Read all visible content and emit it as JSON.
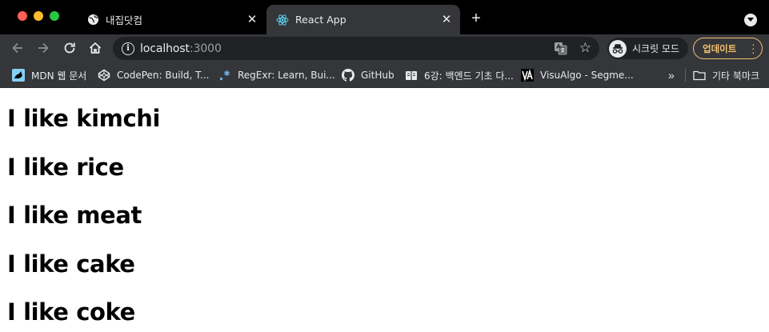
{
  "browser": {
    "tabs": [
      {
        "title": "내집닷컴",
        "favicon": "globe-icon",
        "active": false
      },
      {
        "title": "React App",
        "favicon": "react-icon",
        "active": true
      }
    ],
    "address": {
      "host": "localhost",
      "port": ":3000"
    },
    "incognito_label": "시크릿 모드",
    "update_label": "업데이트",
    "bookmarks": [
      {
        "label": "MDN 웹 문서",
        "icon": "mdn-icon"
      },
      {
        "label": "CodePen: Build, T...",
        "icon": "codepen-icon"
      },
      {
        "label": "RegExr: Learn, Bui...",
        "icon": "regexr-icon"
      },
      {
        "label": "GitHub",
        "icon": "github-icon"
      },
      {
        "label": "6강: 백엔드 기초 다...",
        "icon": "book-icon"
      },
      {
        "label": "VisuAlgo - Segme...",
        "icon": "visualgo-icon"
      }
    ],
    "other_bookmarks_label": "기타 북마크"
  },
  "page": {
    "items": [
      "I like kimchi",
      "I like rice",
      "I like meat",
      "I like cake",
      "I like coke"
    ]
  },
  "colors": {
    "update_accent": "#f6c26b",
    "toolbar": "#35363a",
    "tabstrip": "#000000"
  }
}
